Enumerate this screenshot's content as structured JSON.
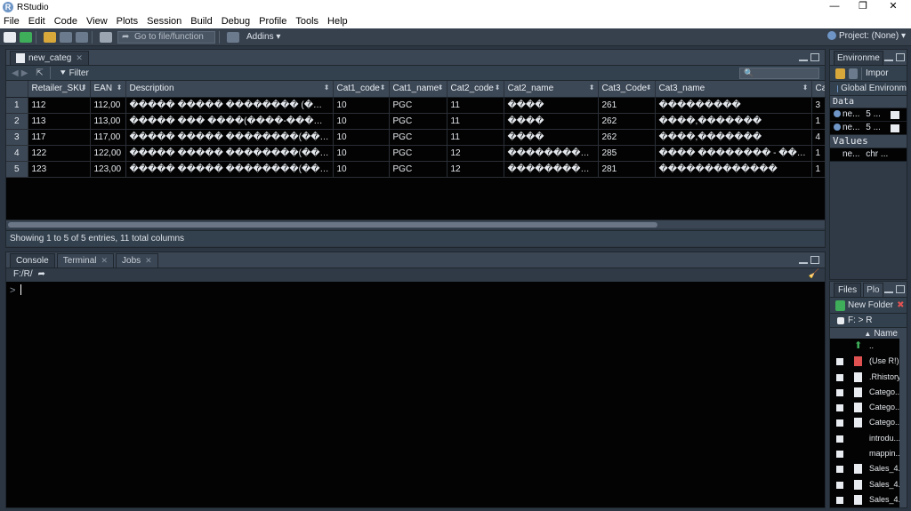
{
  "window": {
    "title": "RStudio",
    "controls": [
      "—",
      "❐",
      "✕"
    ]
  },
  "menu": [
    "File",
    "Edit",
    "Code",
    "View",
    "Plots",
    "Session",
    "Build",
    "Debug",
    "Profile",
    "Tools",
    "Help"
  ],
  "toolbar": {
    "goto_placeholder": "Go to file/function",
    "addins_label": "Addins ▾",
    "project_label": "Project: (None) ▾"
  },
  "viewer": {
    "tab_label": "new_categ",
    "filter_label": "Filter",
    "columns": [
      "Retailer_SKU",
      "EAN",
      "Description",
      "Cat1_code",
      "Cat1_name",
      "Cat2_code",
      "Cat2_name",
      "Cat3_Code",
      "Cat3_name",
      "Cat"
    ],
    "rows": [
      [
        "1",
        "112",
        "112,00",
        "����� ����� �������� (����)",
        "10",
        "PGC",
        "11",
        "����",
        "261",
        "���������",
        "3"
      ],
      [
        "2",
        "113",
        "113,00",
        "����� ��� ����(����-����-XYM-ANA��)",
        "10",
        "PGC",
        "11",
        "����",
        "262",
        "����,�������",
        "1"
      ],
      [
        "3",
        "117",
        "117,00",
        "����� ����� ��������(����-������)",
        "10",
        "PGC",
        "11",
        "����",
        "262",
        "����,�������",
        "4"
      ],
      [
        "4",
        "122",
        "122,00",
        "����� ����� ��������(���� �����...",
        "10",
        "PGC",
        "12",
        "�������������",
        "285",
        "���� �������� - ���������",
        "1"
      ],
      [
        "5",
        "123",
        "123,00",
        "����� ����� ��������(�������-��...",
        "10",
        "PGC",
        "12",
        "�������������",
        "281",
        "�������������",
        "1"
      ]
    ],
    "status": "Showing 1 to 5 of 5 entries, 11 total columns"
  },
  "console": {
    "tabs": [
      "Console",
      "Terminal",
      "Jobs"
    ],
    "path": "F:/R/",
    "prompt": ">"
  },
  "environment": {
    "tab_label": "Environme",
    "import_label": "Impor",
    "scope_label": "Global Environm",
    "data_header": "Data",
    "data_rows": [
      {
        "name": "ne...",
        "value": "5 ..."
      },
      {
        "name": "ne...",
        "value": "5 ..."
      }
    ],
    "values_header": "Values",
    "value_rows": [
      {
        "name": "ne...",
        "value": "chr ..."
      }
    ]
  },
  "files": {
    "tabs": [
      "Files",
      "Plo"
    ],
    "new_folder_label": "New Folder",
    "path": "F: > R",
    "name_header": "Name",
    "items": [
      "..",
      "(Use R!)...",
      ".Rhistory",
      "Catego...",
      "Catego...",
      "Catego...",
      "introdu...",
      "mappin...",
      "Sales_4...",
      "Sales_4...",
      "Sales_4..."
    ]
  },
  "colors": {
    "pane_bg": "#2f3a46",
    "grid_bg": "#030303",
    "header_bg": "#3d4856",
    "accent": "#6e95c6"
  }
}
